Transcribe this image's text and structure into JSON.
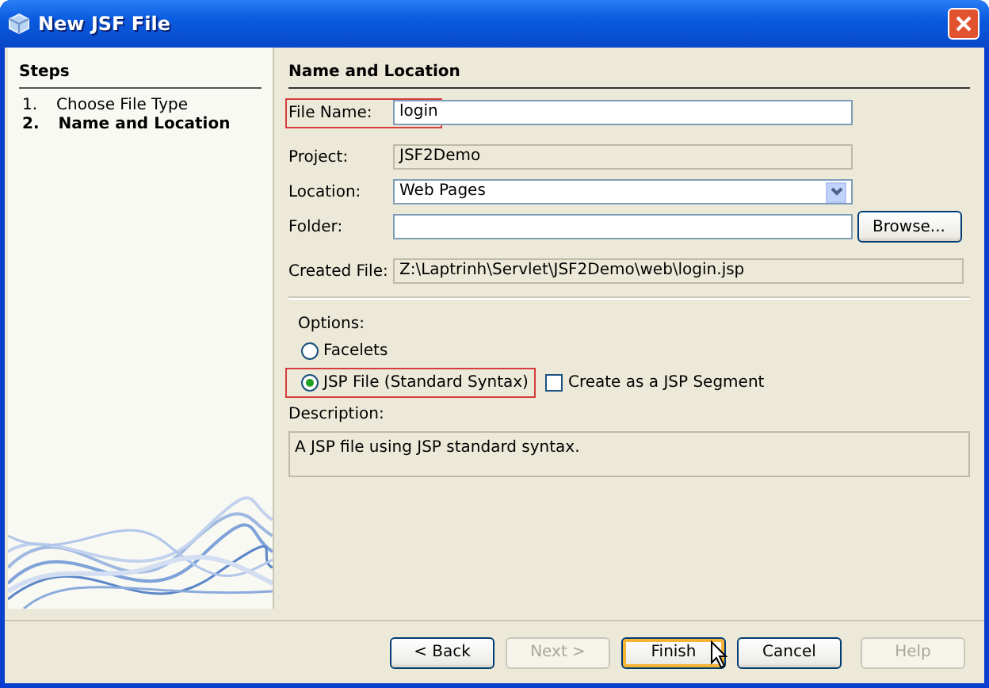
{
  "window": {
    "title": "New JSF File"
  },
  "steps": {
    "title": "Steps",
    "items": [
      {
        "number": "1.",
        "label": "Choose File Type",
        "selected": false
      },
      {
        "number": "2.",
        "label": "Name and Location",
        "selected": true
      }
    ]
  },
  "panel": {
    "title": "Name and Location"
  },
  "fields": [
    {
      "kind": "text",
      "label": "File Name:",
      "value": "login",
      "highlighted": true
    },
    {
      "kind": "readonly",
      "label": "Project:",
      "value": "JSF2Demo",
      "highlighted": false
    },
    {
      "kind": "select",
      "label": "Location:",
      "value": "Web Pages",
      "highlighted": false
    },
    {
      "kind": "browse",
      "label": "Folder:",
      "button": "Browse...",
      "highlighted": false
    },
    {
      "kind": "readonly",
      "label": "Created File:",
      "value": "Z:\\Laptrinh\\Servlet\\JSF2Demo\\web\\login.jsp",
      "highlighted": false
    }
  ],
  "options": {
    "label": "Options:",
    "radios": [
      {
        "label": "Facelets",
        "selected": false,
        "highlighted": false
      },
      {
        "label": "JSP File (Standard Syntax)",
        "selected": true,
        "highlighted": true
      }
    ],
    "checkbox": {
      "label": "Create as a JSP Segment",
      "checked": false
    }
  },
  "description": {
    "label": "Description:",
    "text": "A JSP file using JSP standard syntax."
  },
  "buttons": [
    {
      "label": "< Back",
      "disabled": false,
      "focused": false
    },
    {
      "label": "Next >",
      "disabled": true,
      "focused": false
    },
    {
      "label": "Finish",
      "disabled": false,
      "focused": true
    },
    {
      "label": "Cancel",
      "disabled": false,
      "focused": false
    },
    {
      "label": "Help",
      "disabled": true,
      "focused": false
    }
  ]
}
